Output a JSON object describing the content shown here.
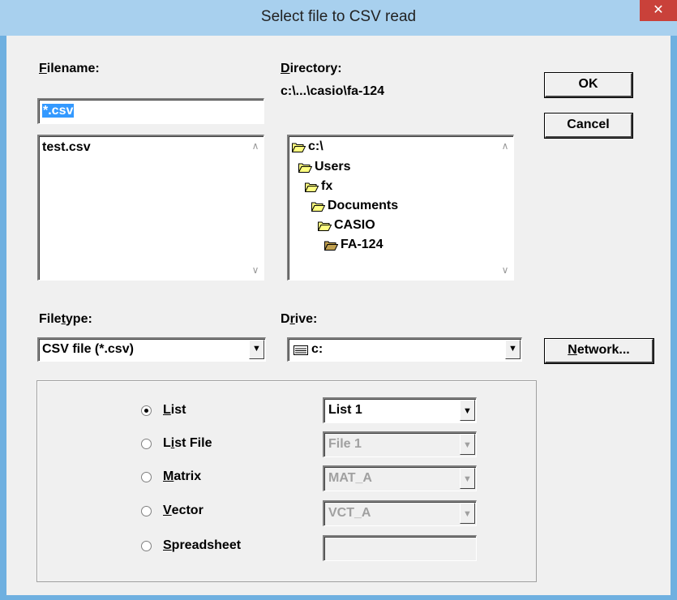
{
  "window": {
    "title": "Select file to CSV read",
    "close_glyph": "✕"
  },
  "filename": {
    "label_prefix": "",
    "label_accel": "F",
    "label_rest": "ilename:",
    "value": "*.csv",
    "files": [
      "test.csv"
    ]
  },
  "directory": {
    "label_accel": "D",
    "label_rest": "irectory:",
    "path": "c:\\...\\casio\\fa-124",
    "tree": [
      "c:\\",
      "Users",
      "fx",
      "Documents",
      "CASIO",
      "FA-124"
    ]
  },
  "buttons": {
    "ok": "OK",
    "cancel": "Cancel",
    "network_accel": "N",
    "network_rest": "etwork..."
  },
  "filetype": {
    "label_pre": "File",
    "label_accel": "t",
    "label_rest": "ype:",
    "value": "CSV file (*.csv)"
  },
  "drive": {
    "label_pre": "D",
    "label_accel": "r",
    "label_rest": "ive:",
    "value": "c:"
  },
  "options": {
    "selected": "List",
    "radios": [
      {
        "pre": "",
        "accel": "L",
        "rest": "ist",
        "value": "List 1",
        "enabled": true
      },
      {
        "pre": "L",
        "accel": "i",
        "rest": "st File",
        "value": "File 1",
        "enabled": false
      },
      {
        "pre": "",
        "accel": "M",
        "rest": "atrix",
        "value": "MAT_A",
        "enabled": false
      },
      {
        "pre": "",
        "accel": "V",
        "rest": "ector",
        "value": "VCT_A",
        "enabled": false
      },
      {
        "pre": "",
        "accel": "S",
        "rest": "preadsheet",
        "value": "",
        "enabled": false
      }
    ]
  },
  "colors": {
    "titlebar": "#a8d0ee",
    "close": "#c9413a",
    "selection": "#3399ff",
    "folder": "#ffff80"
  }
}
